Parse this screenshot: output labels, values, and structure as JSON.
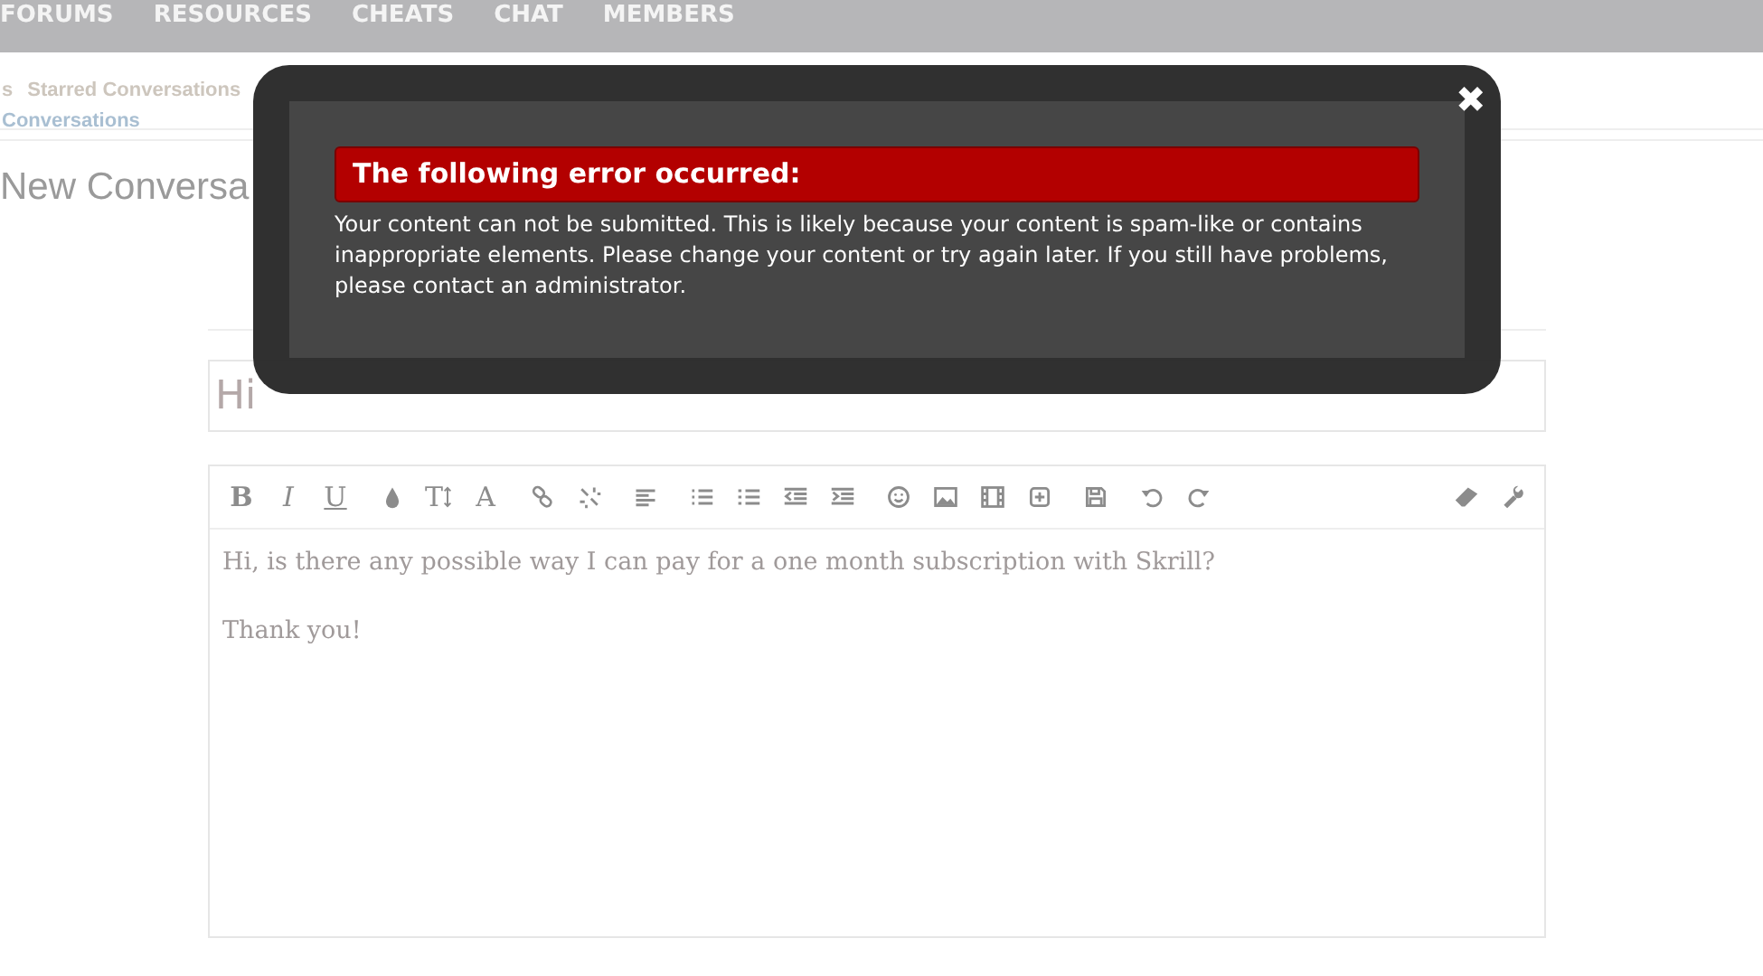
{
  "nav": [
    {
      "label": "FORUMS"
    },
    {
      "label": "RESOURCES"
    },
    {
      "label": "CHEATS"
    },
    {
      "label": "CHAT"
    },
    {
      "label": "MEMBERS"
    }
  ],
  "subnav": [
    {
      "label": "s"
    },
    {
      "label": "Starred Conversations"
    }
  ],
  "crumb": "Conversations",
  "heading": "New Conversa",
  "title_field": {
    "value": "Hi"
  },
  "toolbar": [
    {
      "items": [
        {
          "kind": "bold",
          "label": "B"
        },
        {
          "kind": "italic",
          "label": "I"
        },
        {
          "kind": "underline",
          "label": "U"
        }
      ]
    },
    {
      "items": [
        {
          "kind": "drop"
        },
        {
          "kind": "size",
          "label": "T"
        },
        {
          "kind": "font",
          "label": "A"
        }
      ]
    },
    {
      "items": [
        {
          "kind": "link"
        },
        {
          "kind": "unlink"
        }
      ]
    },
    {
      "items": [
        {
          "kind": "align"
        }
      ]
    },
    {
      "items": [
        {
          "kind": "bullets"
        },
        {
          "kind": "numbers"
        },
        {
          "kind": "outdent"
        },
        {
          "kind": "indent"
        }
      ]
    },
    {
      "items": [
        {
          "kind": "smiley"
        },
        {
          "kind": "image"
        },
        {
          "kind": "film"
        },
        {
          "kind": "plus"
        }
      ]
    },
    {
      "items": [
        {
          "kind": "floppy"
        }
      ]
    },
    {
      "items": [
        {
          "kind": "undo"
        },
        {
          "kind": "redo"
        }
      ]
    }
  ],
  "toolbar_right": [
    {
      "kind": "eraser"
    },
    {
      "kind": "wrench"
    }
  ],
  "message": [
    {
      "text": "Hi, is there any possible way I can pay for a one month subscription with Skrill?"
    },
    {
      "text": "Thank you!"
    }
  ],
  "dialog": {
    "close": "✖",
    "title": "The following error occurred:",
    "body": "Your content can not be submitted. This is likely because your content is spam-like or contains inappropriate elements. Please change your content or try again later. If you still have problems, please contact an administrator."
  }
}
